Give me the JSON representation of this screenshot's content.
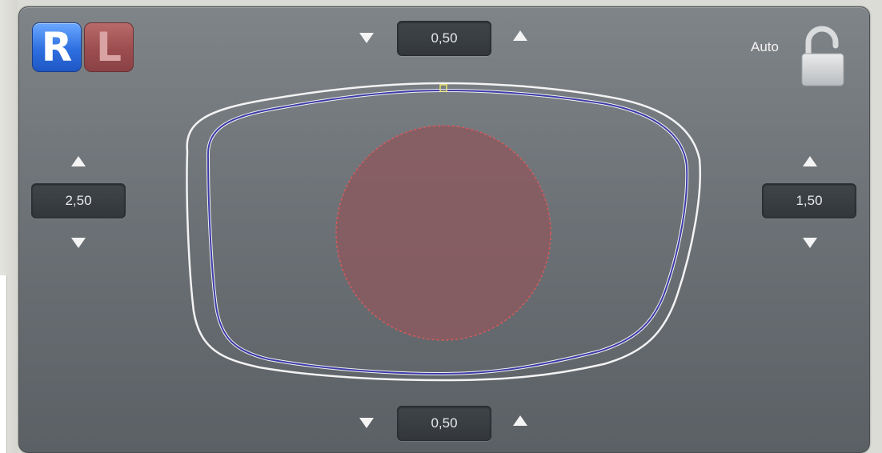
{
  "eye_selector": {
    "right_label": "R",
    "left_label": "L",
    "selected": "R"
  },
  "margins": {
    "top": "0,50",
    "bottom": "0,50",
    "left": "2,50",
    "right": "1,50"
  },
  "lock": {
    "mode_label": "Auto",
    "state": "unlocked"
  },
  "icons": {
    "up": "up-arrow-icon",
    "down": "down-arrow-icon",
    "lock": "padlock-open-icon"
  },
  "colors": {
    "panel": "#6f7479",
    "right_eye_accent": "#2e6fe0",
    "left_eye_accent": "#9c4d4f",
    "lens_outline": "#3b3aa8",
    "frame_outline": "#f2f2f2",
    "optical_zone": "#8a5a60"
  }
}
